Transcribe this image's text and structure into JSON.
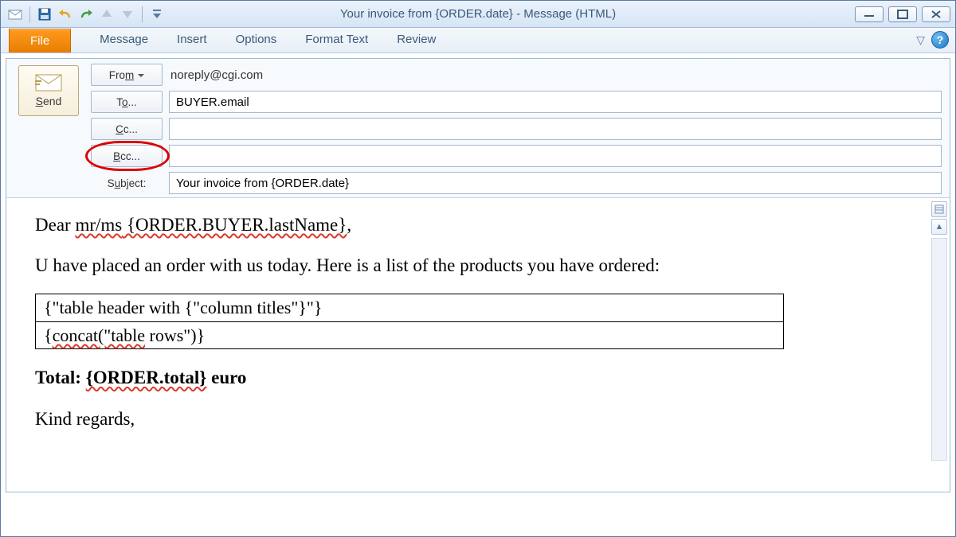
{
  "window": {
    "title": "Your invoice from {ORDER.date}  -  Message (HTML)"
  },
  "qat": {
    "icons": [
      "mail-icon",
      "save-icon",
      "undo-icon",
      "redo-icon",
      "prev-icon",
      "next-icon",
      "customize-icon"
    ]
  },
  "ribbon": {
    "file": "File",
    "tabs": [
      "Message",
      "Insert",
      "Options",
      "Format Text",
      "Review"
    ]
  },
  "send_label": "Send",
  "fields": {
    "from_label": "From",
    "from_value": "noreply@cgi.com",
    "to_label": "To...",
    "to_value": "BUYER.email",
    "cc_label": "Cc...",
    "cc_value": "",
    "bcc_label": "Bcc...",
    "bcc_value": "",
    "subject_label": "Subject:",
    "subject_value": "Your invoice from {ORDER.date}"
  },
  "body": {
    "greeting_prefix": "Dear ",
    "greeting_salut": "mr/ms",
    "greeting_name": " {ORDER.BUYER.lastName}",
    "greeting_suffix": ",",
    "intro": "U have placed an order with us today. Here is a list of the products you have ordered:",
    "table_row1": "{\"table header with {\"column titles\"}\"}",
    "table_row2_a": "{",
    "table_row2_b": "concat(\"table",
    "table_row2_c": " rows\")}",
    "total_label": "Total: ",
    "total_value": "{ORDER.total}",
    "total_unit": " euro",
    "signoff": "Kind regards,"
  }
}
